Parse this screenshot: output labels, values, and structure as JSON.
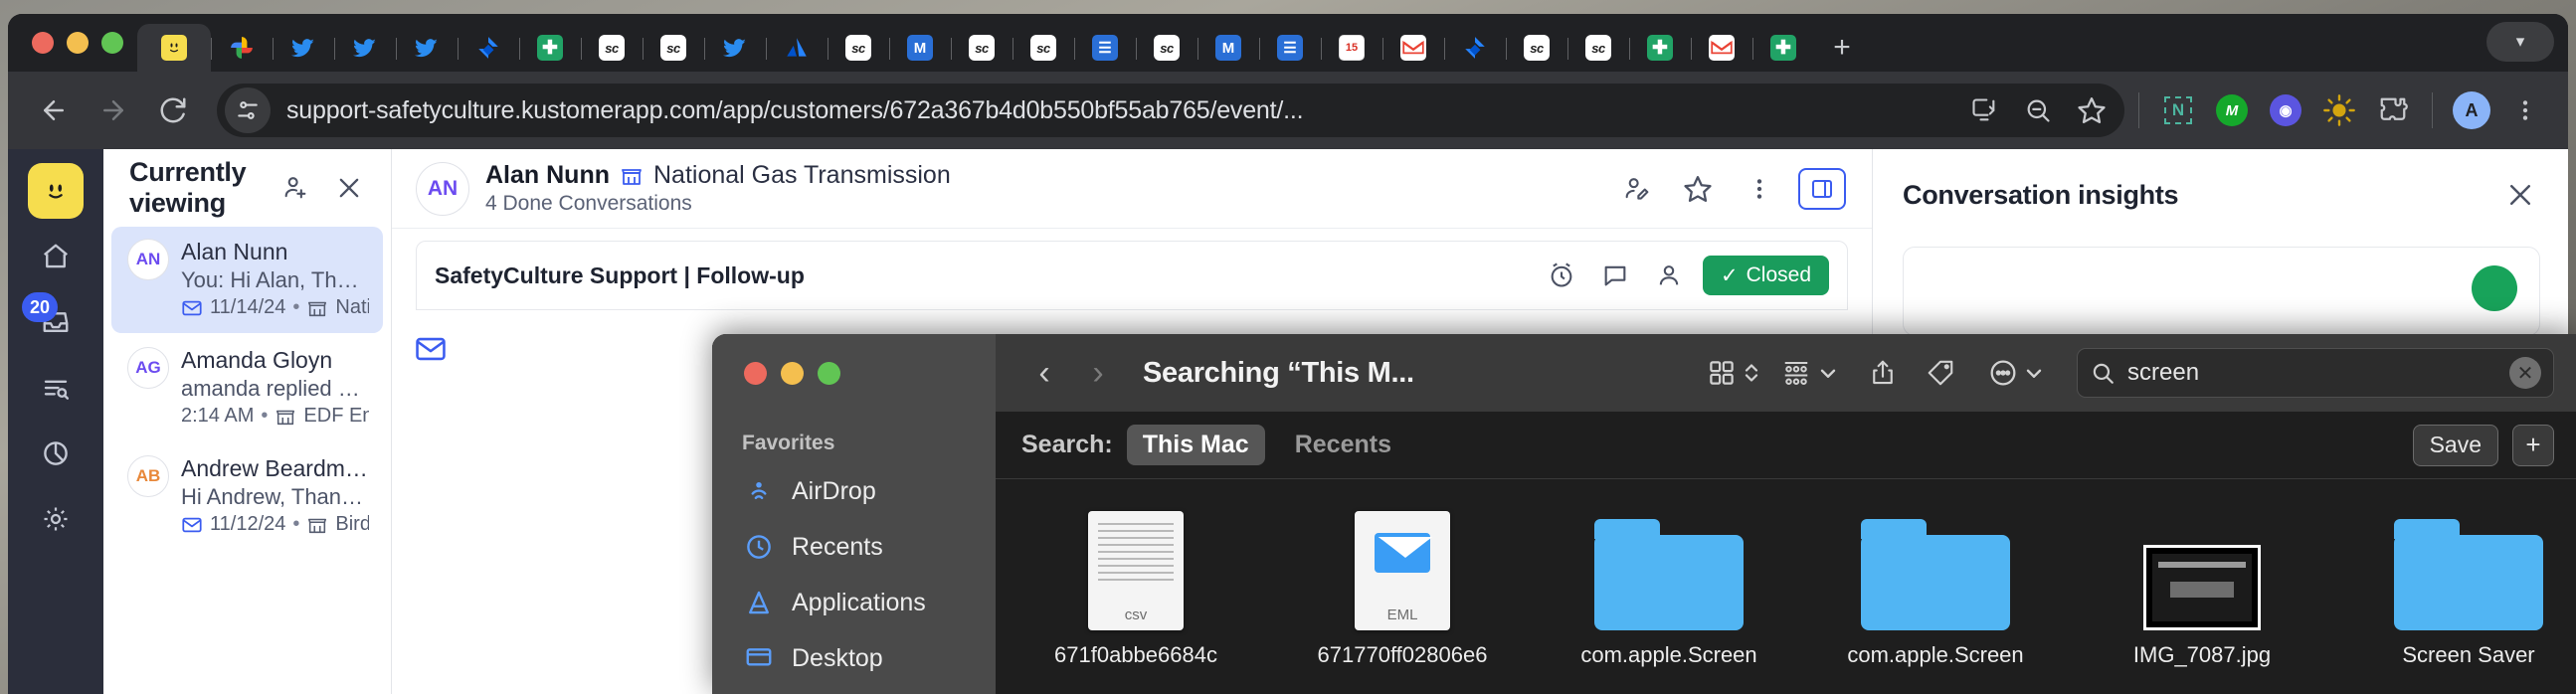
{
  "browser": {
    "window_controls": [
      "close",
      "minimize",
      "maximize"
    ],
    "tabs": [
      {
        "icon": "smiley-face-icon",
        "active": true
      },
      {
        "icon": "google-photos-icon",
        "active": false
      },
      {
        "icon": "twitter-bird-icon",
        "active": false
      },
      {
        "icon": "twitter-bird-icon",
        "active": false
      },
      {
        "icon": "twitter-bird-icon",
        "active": false
      },
      {
        "icon": "jira-icon",
        "active": false
      },
      {
        "icon": "sheets-icon",
        "active": false
      },
      {
        "icon": "safetyculture-sc-icon",
        "active": false
      },
      {
        "icon": "safetyculture-sc-icon",
        "active": false
      },
      {
        "icon": "twitter-bird-icon",
        "active": false
      },
      {
        "icon": "atlassian-icon",
        "active": false
      },
      {
        "icon": "safetyculture-sc-icon",
        "active": false
      },
      {
        "icon": "miro-m-icon",
        "active": false
      },
      {
        "icon": "safetyculture-sc-icon",
        "active": false
      },
      {
        "icon": "safetyculture-sc-icon",
        "active": false
      },
      {
        "icon": "docs-icon",
        "active": false
      },
      {
        "icon": "safetyculture-sc-icon",
        "active": false
      },
      {
        "icon": "miro-m-icon",
        "active": false
      },
      {
        "icon": "docs-icon",
        "active": false
      },
      {
        "icon": "calendar-15-icon",
        "active": false,
        "label": "15"
      },
      {
        "icon": "gmail-icon",
        "active": false
      },
      {
        "icon": "jira-icon",
        "active": false
      },
      {
        "icon": "safetyculture-sc-icon",
        "active": false
      },
      {
        "icon": "safetyculture-sc-icon",
        "active": false
      },
      {
        "icon": "sheets-icon",
        "active": false
      },
      {
        "icon": "gmail-icon",
        "active": false
      },
      {
        "icon": "sheets-icon",
        "active": false
      }
    ],
    "new_tab_label": "+",
    "tab_list_chevron": "chevron-down-icon",
    "toolbar": {
      "back": "back-arrow-icon",
      "forward": "forward-arrow-icon",
      "reload": "reload-icon",
      "site_info": "tune-settings-icon",
      "url": "support-safetyculture.kustomerapp.com/app/customers/672a367b4d0b550bf55ab765/event/...",
      "install_icon": "install-app-icon",
      "zoom_icon": "zoom-out-icon",
      "bookmark_icon": "star-icon",
      "extensions": [
        {
          "name": "notion-n-icon",
          "letter": "N",
          "color": "#4db6a0"
        },
        {
          "name": "grammarly-icon",
          "letter": "M",
          "color": "#15a82b"
        },
        {
          "name": "loom-icon",
          "letter": "",
          "color": "#5b55e0"
        },
        {
          "name": "sun-icon",
          "letter": "",
          "color": "#d3a50f"
        },
        {
          "name": "extensions-puzzle-icon",
          "letter": "",
          "color": "#9aa0a6"
        }
      ],
      "profile_initial": "A",
      "menu_icon": "three-dots-vertical-icon"
    }
  },
  "kustomer": {
    "rail": {
      "logo": "kustomer-smiley-logo",
      "items": [
        {
          "name": "home-icon"
        },
        {
          "name": "inbox-icon",
          "badge": "20"
        },
        {
          "name": "search-list-icon"
        },
        {
          "name": "reports-pie-icon"
        },
        {
          "name": "settings-gear-icon"
        }
      ]
    },
    "currently_viewing": {
      "title": "Currently viewing",
      "add_user_icon": "add-person-icon",
      "close_icon": "close-x-icon",
      "items": [
        {
          "initials": "AN",
          "name": "Alan Nunn",
          "preview": "You: Hi Alan, Thanks for the up...",
          "channel_icon": "email-icon",
          "date": "11/14/24",
          "org_icon": "company-icon",
          "org": "National Gas Trans...",
          "selected": true
        },
        {
          "initials": "AG",
          "name": "Amanda Gloyn",
          "preview": "amanda replied on the other ca...",
          "channel_icon": "",
          "date": "2:14 AM",
          "org_icon": "company-icon",
          "org": "EDF Energy Training",
          "selected": false
        },
        {
          "initials": "AB",
          "name": "Andrew Beardmore",
          "preview": "Hi Andrew, Thanks for the upd...",
          "channel_icon": "email-icon",
          "date": "11/12/24",
          "org_icon": "company-icon",
          "org": "Bird Fellows",
          "selected": false
        }
      ]
    },
    "conversation": {
      "avatar_initials": "AN",
      "customer_name": "Alan Nunn",
      "company_icon": "company-icon",
      "company": "National Gas Transmission",
      "subtitle": "4 Done Conversations",
      "actions": [
        {
          "name": "edit-person-icon"
        },
        {
          "name": "star-icon"
        },
        {
          "name": "more-vertical-icon"
        },
        {
          "name": "panel-toggle-icon"
        }
      ],
      "message_title": "SafetyCulture Support | Follow-up",
      "message_icons": [
        "snooze-icon",
        "comment-icon",
        "person-icon"
      ],
      "status_label": "Closed",
      "channel_icon": "email-icon"
    },
    "insights": {
      "title": "Conversation insights",
      "close_icon": "close-x-icon"
    }
  },
  "finder": {
    "window_controls": [
      "close",
      "minimize",
      "maximize"
    ],
    "nav": {
      "back": "chevron-left-icon",
      "forward": "chevron-right-icon"
    },
    "title": "Searching “This M...",
    "toolbar_icons": [
      {
        "name": "grid-view-icon"
      },
      {
        "name": "sort-chevrons-icon"
      },
      {
        "name": "group-by-icon"
      },
      {
        "name": "chevron-down-icon"
      },
      {
        "name": "share-icon"
      },
      {
        "name": "tag-icon"
      },
      {
        "name": "more-actions-icon"
      },
      {
        "name": "chevron-down-icon"
      }
    ],
    "search": {
      "icon": "search-icon",
      "value": "screen",
      "clear_icon": "clear-circle-icon"
    },
    "sidebar": {
      "heading": "Favorites",
      "items": [
        {
          "label": "AirDrop",
          "icon": "airdrop-icon"
        },
        {
          "label": "Recents",
          "icon": "clock-icon"
        },
        {
          "label": "Applications",
          "icon": "applications-icon"
        },
        {
          "label": "Desktop",
          "icon": "desktop-icon"
        }
      ]
    },
    "search_bar": {
      "label": "Search:",
      "scopes": [
        {
          "label": "This Mac",
          "active": true
        },
        {
          "label": "Recents",
          "active": false
        }
      ],
      "save_label": "Save",
      "add_label": "+"
    },
    "files": [
      {
        "name": "671f0abbe6684c",
        "type": "csv",
        "badge": "csv"
      },
      {
        "name": "671770ff02806e6",
        "type": "eml",
        "badge": "EML"
      },
      {
        "name": "com.apple.Screen",
        "type": "folder",
        "badge": ""
      },
      {
        "name": "com.apple.Screen",
        "type": "folder",
        "badge": ""
      },
      {
        "name": "IMG_7087.jpg",
        "type": "image",
        "badge": ""
      },
      {
        "name": "Screen Saver",
        "type": "folder",
        "badge": ""
      }
    ]
  }
}
